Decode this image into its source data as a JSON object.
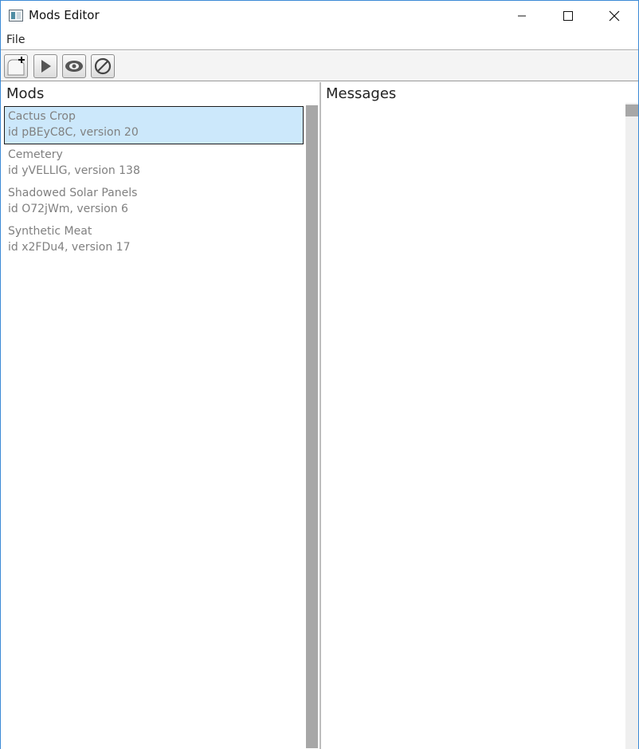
{
  "window": {
    "title": "Mods Editor",
    "icon": "app-window-icon",
    "controls": [
      "minimize-icon",
      "maximize-icon",
      "close-icon"
    ]
  },
  "menu": {
    "items": [
      {
        "label": "File"
      }
    ]
  },
  "toolbar": {
    "buttons": [
      {
        "icon": "new-document-icon"
      },
      {
        "icon": "play-icon"
      },
      {
        "icon": "eye-icon"
      },
      {
        "icon": "disable-icon"
      }
    ]
  },
  "mods_pane": {
    "title": "Mods",
    "items": [
      {
        "name": "Cactus Crop",
        "meta": "id pBEyC8C, version 20",
        "selected": true
      },
      {
        "name": "Cemetery",
        "meta": "id yVELLIG, version 138",
        "selected": false
      },
      {
        "name": "Shadowed Solar Panels",
        "meta": "id O72jWm, version 6",
        "selected": false
      },
      {
        "name": "Synthetic Meat",
        "meta": "id x2FDu4, version 17",
        "selected": false
      }
    ]
  },
  "messages_pane": {
    "title": "Messages"
  },
  "colors": {
    "window_border": "#3c8ad6",
    "selection_fill": "#cce8fb",
    "scrollbar": "#a7a7a7",
    "muted_text": "#808080"
  }
}
